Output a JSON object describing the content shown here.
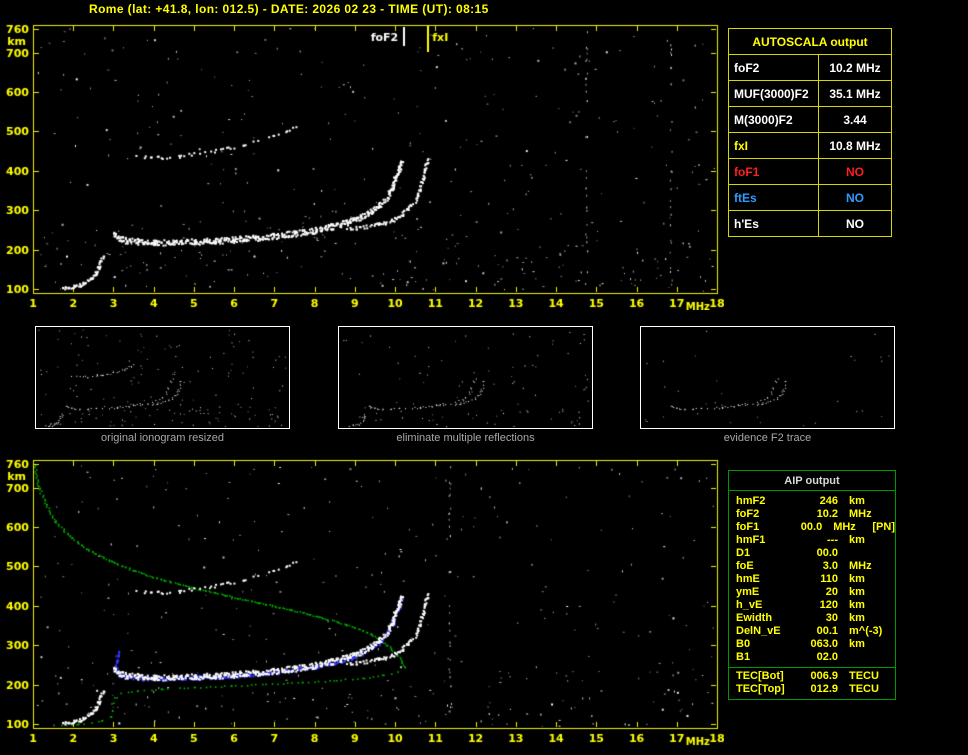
{
  "header": {
    "title": "Rome (lat: +41.8, lon: 012.5) - DATE: 2026 02 23 - TIME (UT): 08:15"
  },
  "colors": {
    "background": "#000000",
    "axis_yellow": "#f2f200",
    "label_yellow": "#ffff00",
    "white": "#ffffff",
    "red": "#ff1f1f",
    "blue": "#2e9bff",
    "green": "#00ae00",
    "restored_blue": "#3535ff",
    "caption_gray": "#a8a8a8",
    "aip_header_gray": "#d8d8d8"
  },
  "autoscala": {
    "header": "AUTOSCALA output",
    "rows": [
      {
        "label": "foF2",
        "value": "10.2 MHz",
        "label_color": "#ffffff",
        "value_color": "#ffffff"
      },
      {
        "label": "MUF(3000)F2",
        "value": "35.1 MHz",
        "label_color": "#ffffff",
        "value_color": "#ffffff"
      },
      {
        "label": "M(3000)F2",
        "value": "3.44",
        "label_color": "#ffffff",
        "value_color": "#ffffff"
      },
      {
        "label": "fxI",
        "value": "10.8 MHz",
        "label_color": "#ffff00",
        "value_color": "#ffffff"
      },
      {
        "label": "foF1",
        "value": "NO",
        "label_color": "#ff1f1f",
        "value_color": "#ff1f1f"
      },
      {
        "label": "ftEs",
        "value": "NO",
        "label_color": "#2e9bff",
        "value_color": "#2e9bff"
      },
      {
        "label": "h'Es",
        "value": "NO",
        "label_color": "#ffffff",
        "value_color": "#ffffff"
      }
    ]
  },
  "thumbnails": [
    {
      "caption": "original ionogram resized",
      "traces": [
        "f2_ordinary",
        "f2_extraordinary",
        "f2_second_hop",
        "es_sporadic"
      ],
      "noise_count": 170,
      "noise_seed": 3
    },
    {
      "caption": "eliminate multiple reflections",
      "traces": [
        "f2_ordinary",
        "f2_extraordinary",
        "es_sporadic"
      ],
      "noise_count": 95,
      "noise_seed": 4
    },
    {
      "caption": "evidence F2 trace",
      "traces": [
        "f2_ordinary",
        "f2_extraordinary"
      ],
      "noise_count": 30,
      "noise_seed": 5
    }
  ],
  "aip": {
    "header": "AIP output",
    "rows": [
      {
        "name": "hmF2",
        "value": "246",
        "unit": "km",
        "extra": ""
      },
      {
        "name": "foF2",
        "value": "10.2",
        "unit": "MHz",
        "extra": ""
      },
      {
        "name": "foF1",
        "value": "00.0",
        "unit": "MHz",
        "extra": "[PN]"
      },
      {
        "name": "hmF1",
        "value": "---",
        "unit": "km",
        "extra": ""
      },
      {
        "name": "D1",
        "value": "00.0",
        "unit": "",
        "extra": ""
      },
      {
        "name": "foE",
        "value": "3.0",
        "unit": "MHz",
        "extra": ""
      },
      {
        "name": "hmE",
        "value": "110",
        "unit": "km",
        "extra": ""
      },
      {
        "name": "ymE",
        "value": "20",
        "unit": "km",
        "extra": ""
      },
      {
        "name": "h_vE",
        "value": "120",
        "unit": "km",
        "extra": ""
      },
      {
        "name": "Ewidth",
        "value": "30",
        "unit": "km",
        "extra": ""
      },
      {
        "name": "DelN_vE",
        "value": "00.1",
        "unit": "m^(-3)",
        "extra": ""
      },
      {
        "name": "B0",
        "value": "063.0",
        "unit": "km",
        "extra": ""
      },
      {
        "name": "B1",
        "value": "02.0",
        "unit": "",
        "extra": ""
      }
    ],
    "tec_rows": [
      {
        "name": "TEC[Bot]",
        "value": "006.9",
        "unit": "TECU"
      },
      {
        "name": "TEC[Top]",
        "value": "012.9",
        "unit": "TECU"
      }
    ]
  },
  "chart_data": {
    "type": "scatter",
    "title": "Rome ionogram autoscaled (AUTOSCALA / AIP)",
    "x_axis": {
      "label": "MHz",
      "range": [
        1,
        18
      ],
      "ticks": [
        1,
        2,
        3,
        4,
        5,
        6,
        7,
        8,
        9,
        10,
        11,
        12,
        13,
        14,
        15,
        16,
        17,
        18
      ]
    },
    "y_axis": {
      "label": "km",
      "range": [
        100,
        760
      ],
      "ticks": [
        760,
        700,
        600,
        500,
        400,
        300,
        200,
        100
      ]
    },
    "markers": [
      {
        "label": "foF2",
        "freq_mhz": 10.2,
        "color": "#ffffff"
      },
      {
        "label": "fxI",
        "freq_mhz": 10.8,
        "color": "#ffff00"
      }
    ],
    "traces_km_vs_mhz": {
      "f2_ordinary": [
        [
          3.0,
          242
        ],
        [
          3.1,
          231
        ],
        [
          3.3,
          225
        ],
        [
          3.6,
          222
        ],
        [
          4.0,
          220
        ],
        [
          4.5,
          220
        ],
        [
          5.0,
          222
        ],
        [
          5.5,
          224
        ],
        [
          6.0,
          227
        ],
        [
          6.5,
          231
        ],
        [
          7.0,
          236
        ],
        [
          7.5,
          243
        ],
        [
          8.0,
          251
        ],
        [
          8.4,
          260
        ],
        [
          8.8,
          271
        ],
        [
          9.1,
          283
        ],
        [
          9.4,
          298
        ],
        [
          9.6,
          315
        ],
        [
          9.8,
          338
        ],
        [
          9.92,
          362
        ],
        [
          10.0,
          384
        ],
        [
          10.08,
          406
        ],
        [
          10.14,
          426
        ]
      ],
      "f2_extraordinary": [
        [
          8.8,
          252
        ],
        [
          9.2,
          258
        ],
        [
          9.6,
          266
        ],
        [
          9.9,
          276
        ],
        [
          10.15,
          290
        ],
        [
          10.35,
          308
        ],
        [
          10.5,
          331
        ],
        [
          10.6,
          356
        ],
        [
          10.68,
          383
        ],
        [
          10.74,
          409
        ],
        [
          10.79,
          430
        ]
      ],
      "f2_second_hop": [
        [
          3.4,
          441
        ],
        [
          3.8,
          436
        ],
        [
          4.2,
          436
        ],
        [
          4.6,
          439
        ],
        [
          5.0,
          444
        ],
        [
          5.4,
          450
        ],
        [
          5.8,
          458
        ],
        [
          6.2,
          467
        ],
        [
          6.6,
          478
        ],
        [
          7.0,
          491
        ],
        [
          7.3,
          503
        ],
        [
          7.6,
          517
        ]
      ],
      "es_sporadic": [
        [
          1.7,
          103
        ],
        [
          1.85,
          105
        ],
        [
          2.0,
          108
        ],
        [
          2.15,
          112
        ],
        [
          2.3,
          118
        ],
        [
          2.45,
          128
        ],
        [
          2.55,
          142
        ],
        [
          2.62,
          158
        ],
        [
          2.68,
          172
        ],
        [
          2.72,
          186
        ]
      ]
    },
    "profile_plot": {
      "plasma_frequency_profile": {
        "topside": [
          [
            1.02,
            758
          ],
          [
            1.12,
            706
          ],
          [
            1.3,
            658
          ],
          [
            1.55,
            616
          ],
          [
            1.9,
            578
          ],
          [
            2.35,
            544
          ],
          [
            2.9,
            515
          ],
          [
            3.55,
            489
          ],
          [
            4.25,
            466
          ],
          [
            5.0,
            446
          ],
          [
            5.8,
            427
          ],
          [
            6.6,
            409
          ],
          [
            7.4,
            391
          ],
          [
            8.1,
            373
          ],
          [
            8.8,
            353
          ],
          [
            9.4,
            329
          ],
          [
            9.8,
            302
          ],
          [
            10.05,
            275
          ],
          [
            10.17,
            256
          ],
          [
            10.2,
            246
          ]
        ],
        "bottomside": [
          [
            10.2,
            246
          ],
          [
            10.05,
            234
          ],
          [
            9.7,
            225
          ],
          [
            9.2,
            218
          ],
          [
            8.5,
            212
          ],
          [
            7.7,
            207
          ],
          [
            6.8,
            202
          ],
          [
            5.9,
            198
          ],
          [
            5.0,
            194
          ],
          [
            4.2,
            190
          ],
          [
            3.6,
            185
          ],
          [
            3.2,
            179
          ],
          [
            3.05,
            169
          ],
          [
            2.97,
            154
          ],
          [
            2.93,
            136
          ],
          [
            2.9,
            120
          ],
          [
            2.72,
            110
          ],
          [
            2.45,
            104
          ],
          [
            2.1,
            100
          ],
          [
            1.7,
            97
          ]
        ]
      },
      "restored_trace": [
        [
          3.1,
          287
        ],
        [
          3.07,
          265
        ],
        [
          3.05,
          245
        ],
        [
          3.08,
          230
        ],
        [
          3.2,
          223
        ],
        [
          3.4,
          220
        ],
        [
          3.7,
          218
        ],
        [
          4.1,
          217
        ],
        [
          4.6,
          218
        ],
        [
          5.1,
          220
        ],
        [
          5.6,
          222
        ],
        [
          6.1,
          225
        ],
        [
          6.6,
          229
        ],
        [
          7.1,
          234
        ],
        [
          7.6,
          241
        ],
        [
          8.1,
          249
        ],
        [
          8.5,
          258
        ],
        [
          8.9,
          270
        ],
        [
          9.2,
          283
        ],
        [
          9.45,
          297
        ],
        [
          9.65,
          314
        ],
        [
          9.82,
          336
        ],
        [
          9.93,
          358
        ],
        [
          10.02,
          380
        ],
        [
          10.09,
          401
        ],
        [
          10.14,
          420
        ]
      ]
    },
    "noise": {
      "main_seed": 7,
      "main_count": 430,
      "main_interference_mhz": [
        14.75,
        16.85
      ],
      "profile_seed": 13,
      "profile_count": 370,
      "profile_interference_mhz": [
        11.35
      ]
    }
  }
}
